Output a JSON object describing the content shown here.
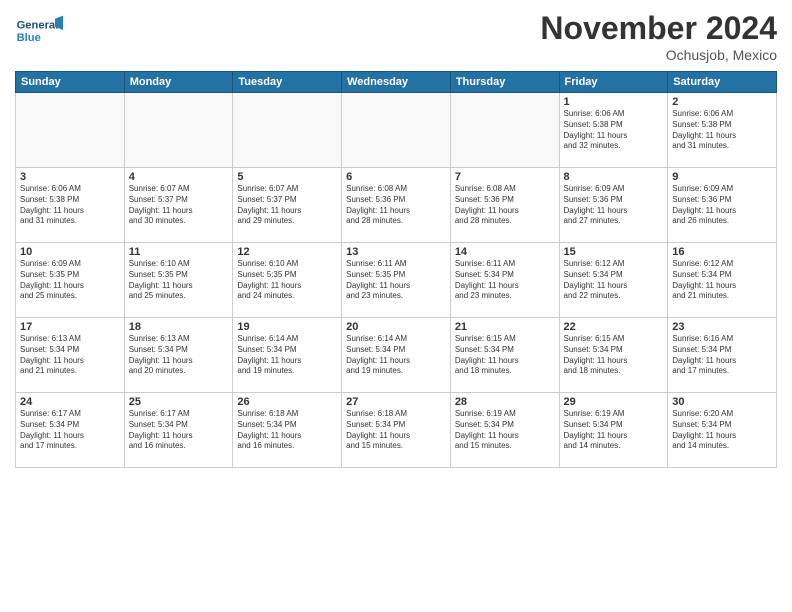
{
  "logo": {
    "line1": "General",
    "line2": "Blue"
  },
  "title": "November 2024",
  "location": "Ochusjob, Mexico",
  "weekdays": [
    "Sunday",
    "Monday",
    "Tuesday",
    "Wednesday",
    "Thursday",
    "Friday",
    "Saturday"
  ],
  "weeks": [
    [
      {
        "day": "",
        "empty": true
      },
      {
        "day": "",
        "empty": true
      },
      {
        "day": "",
        "empty": true
      },
      {
        "day": "",
        "empty": true
      },
      {
        "day": "",
        "empty": true
      },
      {
        "day": "1",
        "info": "Sunrise: 6:06 AM\nSunset: 5:38 PM\nDaylight: 11 hours\nand 32 minutes."
      },
      {
        "day": "2",
        "info": "Sunrise: 6:06 AM\nSunset: 5:38 PM\nDaylight: 11 hours\nand 31 minutes."
      }
    ],
    [
      {
        "day": "3",
        "info": "Sunrise: 6:06 AM\nSunset: 5:38 PM\nDaylight: 11 hours\nand 31 minutes."
      },
      {
        "day": "4",
        "info": "Sunrise: 6:07 AM\nSunset: 5:37 PM\nDaylight: 11 hours\nand 30 minutes."
      },
      {
        "day": "5",
        "info": "Sunrise: 6:07 AM\nSunset: 5:37 PM\nDaylight: 11 hours\nand 29 minutes."
      },
      {
        "day": "6",
        "info": "Sunrise: 6:08 AM\nSunset: 5:36 PM\nDaylight: 11 hours\nand 28 minutes."
      },
      {
        "day": "7",
        "info": "Sunrise: 6:08 AM\nSunset: 5:36 PM\nDaylight: 11 hours\nand 28 minutes."
      },
      {
        "day": "8",
        "info": "Sunrise: 6:09 AM\nSunset: 5:36 PM\nDaylight: 11 hours\nand 27 minutes."
      },
      {
        "day": "9",
        "info": "Sunrise: 6:09 AM\nSunset: 5:36 PM\nDaylight: 11 hours\nand 26 minutes."
      }
    ],
    [
      {
        "day": "10",
        "info": "Sunrise: 6:09 AM\nSunset: 5:35 PM\nDaylight: 11 hours\nand 25 minutes."
      },
      {
        "day": "11",
        "info": "Sunrise: 6:10 AM\nSunset: 5:35 PM\nDaylight: 11 hours\nand 25 minutes."
      },
      {
        "day": "12",
        "info": "Sunrise: 6:10 AM\nSunset: 5:35 PM\nDaylight: 11 hours\nand 24 minutes."
      },
      {
        "day": "13",
        "info": "Sunrise: 6:11 AM\nSunset: 5:35 PM\nDaylight: 11 hours\nand 23 minutes."
      },
      {
        "day": "14",
        "info": "Sunrise: 6:11 AM\nSunset: 5:34 PM\nDaylight: 11 hours\nand 23 minutes."
      },
      {
        "day": "15",
        "info": "Sunrise: 6:12 AM\nSunset: 5:34 PM\nDaylight: 11 hours\nand 22 minutes."
      },
      {
        "day": "16",
        "info": "Sunrise: 6:12 AM\nSunset: 5:34 PM\nDaylight: 11 hours\nand 21 minutes."
      }
    ],
    [
      {
        "day": "17",
        "info": "Sunrise: 6:13 AM\nSunset: 5:34 PM\nDaylight: 11 hours\nand 21 minutes."
      },
      {
        "day": "18",
        "info": "Sunrise: 6:13 AM\nSunset: 5:34 PM\nDaylight: 11 hours\nand 20 minutes."
      },
      {
        "day": "19",
        "info": "Sunrise: 6:14 AM\nSunset: 5:34 PM\nDaylight: 11 hours\nand 19 minutes."
      },
      {
        "day": "20",
        "info": "Sunrise: 6:14 AM\nSunset: 5:34 PM\nDaylight: 11 hours\nand 19 minutes."
      },
      {
        "day": "21",
        "info": "Sunrise: 6:15 AM\nSunset: 5:34 PM\nDaylight: 11 hours\nand 18 minutes."
      },
      {
        "day": "22",
        "info": "Sunrise: 6:15 AM\nSunset: 5:34 PM\nDaylight: 11 hours\nand 18 minutes."
      },
      {
        "day": "23",
        "info": "Sunrise: 6:16 AM\nSunset: 5:34 PM\nDaylight: 11 hours\nand 17 minutes."
      }
    ],
    [
      {
        "day": "24",
        "info": "Sunrise: 6:17 AM\nSunset: 5:34 PM\nDaylight: 11 hours\nand 17 minutes."
      },
      {
        "day": "25",
        "info": "Sunrise: 6:17 AM\nSunset: 5:34 PM\nDaylight: 11 hours\nand 16 minutes."
      },
      {
        "day": "26",
        "info": "Sunrise: 6:18 AM\nSunset: 5:34 PM\nDaylight: 11 hours\nand 16 minutes."
      },
      {
        "day": "27",
        "info": "Sunrise: 6:18 AM\nSunset: 5:34 PM\nDaylight: 11 hours\nand 15 minutes."
      },
      {
        "day": "28",
        "info": "Sunrise: 6:19 AM\nSunset: 5:34 PM\nDaylight: 11 hours\nand 15 minutes."
      },
      {
        "day": "29",
        "info": "Sunrise: 6:19 AM\nSunset: 5:34 PM\nDaylight: 11 hours\nand 14 minutes."
      },
      {
        "day": "30",
        "info": "Sunrise: 6:20 AM\nSunset: 5:34 PM\nDaylight: 11 hours\nand 14 minutes."
      }
    ]
  ]
}
